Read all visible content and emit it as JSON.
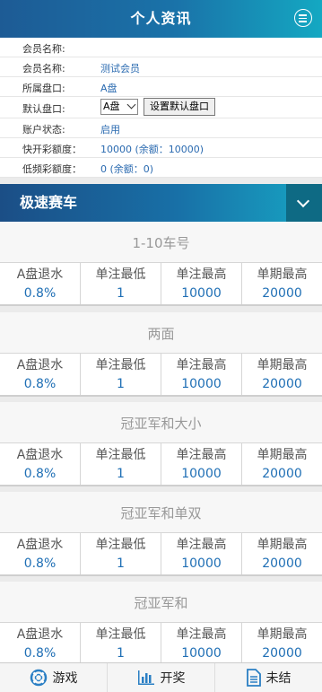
{
  "header": {
    "title": "个人资讯"
  },
  "info": {
    "rows": [
      {
        "label": "会员名称:",
        "value": ""
      },
      {
        "label": "会员名称:",
        "value": "测试会员"
      },
      {
        "label": "所属盘口:",
        "value": "A盘"
      },
      {
        "label": "默认盘口:",
        "select_value": "A盘",
        "button": "设置默认盘口"
      },
      {
        "label": "账户状态:",
        "value": "启用"
      },
      {
        "label": "快开彩额度：",
        "value": "10000 (余额：10000)"
      },
      {
        "label": "低频彩额度：",
        "value": "0 (余额：0)"
      }
    ]
  },
  "section": {
    "title": "极速赛车"
  },
  "col_headers": [
    "A盘退水",
    "单注最低",
    "单注最高",
    "单期最高"
  ],
  "blocks": [
    {
      "title": "1-10车号",
      "values": [
        "0.8%",
        "1",
        "10000",
        "20000"
      ]
    },
    {
      "title": "两面",
      "values": [
        "0.8%",
        "1",
        "10000",
        "20000"
      ]
    },
    {
      "title": "冠亚军和大小",
      "values": [
        "0.8%",
        "1",
        "10000",
        "20000"
      ]
    },
    {
      "title": "冠亚军和单双",
      "values": [
        "0.8%",
        "1",
        "10000",
        "20000"
      ]
    },
    {
      "title": "冠亚军和",
      "values": [
        "0.8%",
        "1",
        "10000",
        "20000"
      ]
    }
  ],
  "tabs": [
    {
      "label": "游戏",
      "icon": "lifebuoy-icon"
    },
    {
      "label": "开奖",
      "icon": "bar-chart-icon"
    },
    {
      "label": "未结",
      "icon": "document-icon"
    }
  ],
  "colors": {
    "accent": "#1a73a9",
    "value_blue": "#1f6fb5"
  }
}
